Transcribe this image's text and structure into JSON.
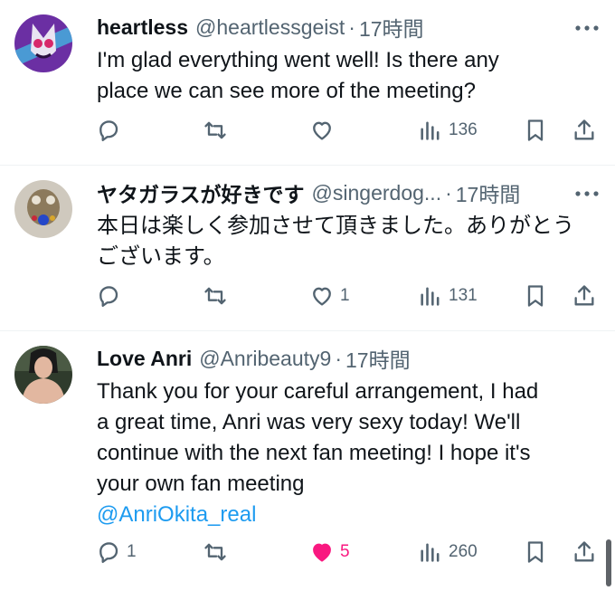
{
  "tweets": [
    {
      "display_name": "heartless",
      "handle": "@heartlessgeist",
      "separator": "·",
      "time": "17時間",
      "text_lines": [
        "I'm glad everything went well! Is there any",
        "place we can see more of the meeting?"
      ],
      "mention": "",
      "replies": "",
      "retweets": "",
      "likes": "",
      "views": "136",
      "liked": false,
      "avatar_colors": {
        "bg": "#6b2fa3",
        "fg": "#e9e4f2",
        "accent": "#d7286a"
      }
    },
    {
      "display_name": "ヤタガラスが好きです",
      "handle": "@singerdog...",
      "separator": "·",
      "time": "17時間",
      "text_lines": [
        "本日は楽しく参加させて頂きました。ありがとう",
        "ございます。"
      ],
      "mention": "",
      "replies": "",
      "retweets": "",
      "likes": "1",
      "views": "131",
      "liked": false,
      "avatar_colors": {
        "bg": "#cfc9be",
        "fg": "#8c7a5c",
        "accent": "#2447c9"
      }
    },
    {
      "display_name": "Love Anri",
      "handle": "@Anribeauty9",
      "separator": "·",
      "time": "17時間",
      "text_lines": [
        "Thank you for your careful arrangement, I had",
        "a great time, Anri was very sexy today! We'll",
        "continue with the next fan meeting! I hope it's",
        "your own fan meeting"
      ],
      "mention": "@AnriOkita_real",
      "replies": "1",
      "retweets": "",
      "likes": "5",
      "views": "260",
      "liked": true,
      "avatar_colors": {
        "bg": "#2f3b2c",
        "fg": "#e2b7a0",
        "accent": "#1a1a1a"
      }
    }
  ],
  "colors": {
    "text": "#0f1419",
    "muted": "#536471",
    "link": "#1d9bf0",
    "like": "#f91880"
  },
  "icons": [
    "reply-icon",
    "retweet-icon",
    "like-icon",
    "views-icon",
    "bookmark-icon",
    "share-icon",
    "more-icon"
  ]
}
